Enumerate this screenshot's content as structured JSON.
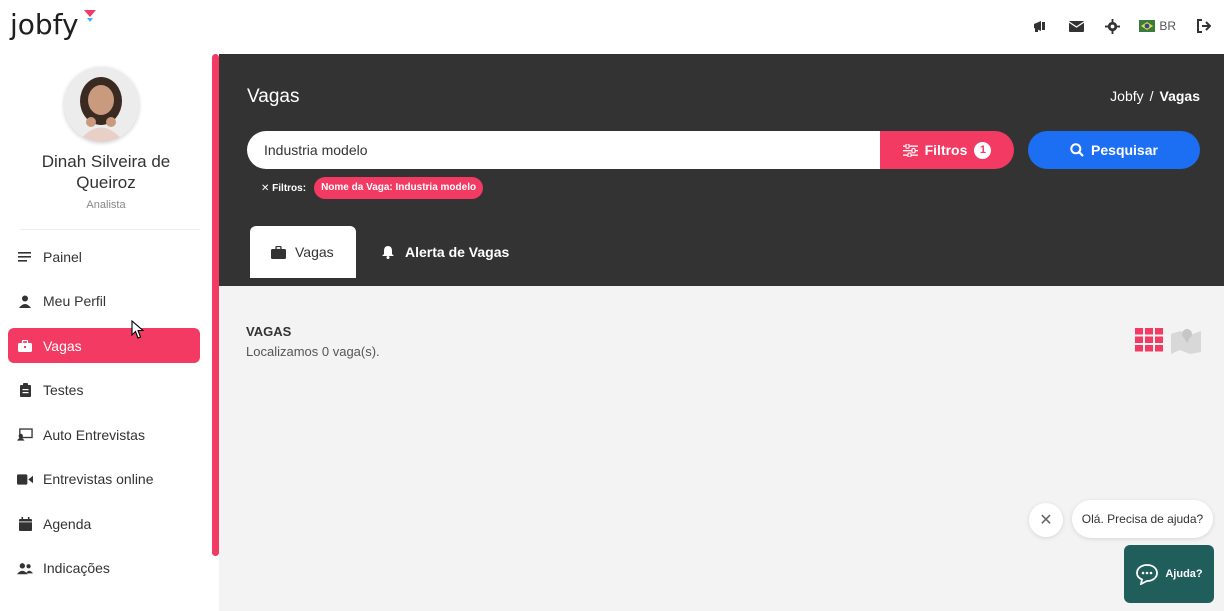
{
  "app": {
    "logo": "jobfy"
  },
  "topbar": {
    "lang": "BR"
  },
  "user": {
    "name": "Dinah Silveira de Queiroz",
    "role": "Analista"
  },
  "sidebar": {
    "items": [
      {
        "label": "Painel",
        "icon": "menu-icon"
      },
      {
        "label": "Meu Perfil",
        "icon": "user-icon"
      },
      {
        "label": "Vagas",
        "icon": "briefcase-icon",
        "active": true
      },
      {
        "label": "Testes",
        "icon": "clipboard-icon"
      },
      {
        "label": "Auto Entrevistas",
        "icon": "presentation-icon"
      },
      {
        "label": "Entrevistas online",
        "icon": "video-icon"
      },
      {
        "label": "Agenda",
        "icon": "calendar-icon"
      },
      {
        "label": "Indicações",
        "icon": "users-icon"
      }
    ]
  },
  "header": {
    "title": "Vagas",
    "breadcrumb": {
      "root": "Jobfy",
      "separator": "/",
      "current": "Vagas"
    }
  },
  "search": {
    "value": "Industria modelo",
    "filters_label": "Filtros",
    "filters_count": "1",
    "search_label": "Pesquisar",
    "active_filters_label": "Filtros:",
    "chip": "Nome da Vaga: Industria modelo"
  },
  "tabs": [
    {
      "label": "Vagas",
      "active": true
    },
    {
      "label": "Alerta de Vagas",
      "active": false
    }
  ],
  "results": {
    "title": "VAGAS",
    "subtitle": "Localizamos 0 vaga(s)."
  },
  "chat": {
    "prompt": "Olá. Precisa de ajuda?",
    "button_label": "Ajuda?"
  },
  "colors": {
    "accent": "#f23a63",
    "primary": "#1c6ef2",
    "dark": "#333333",
    "chat": "#1f5e5b"
  }
}
